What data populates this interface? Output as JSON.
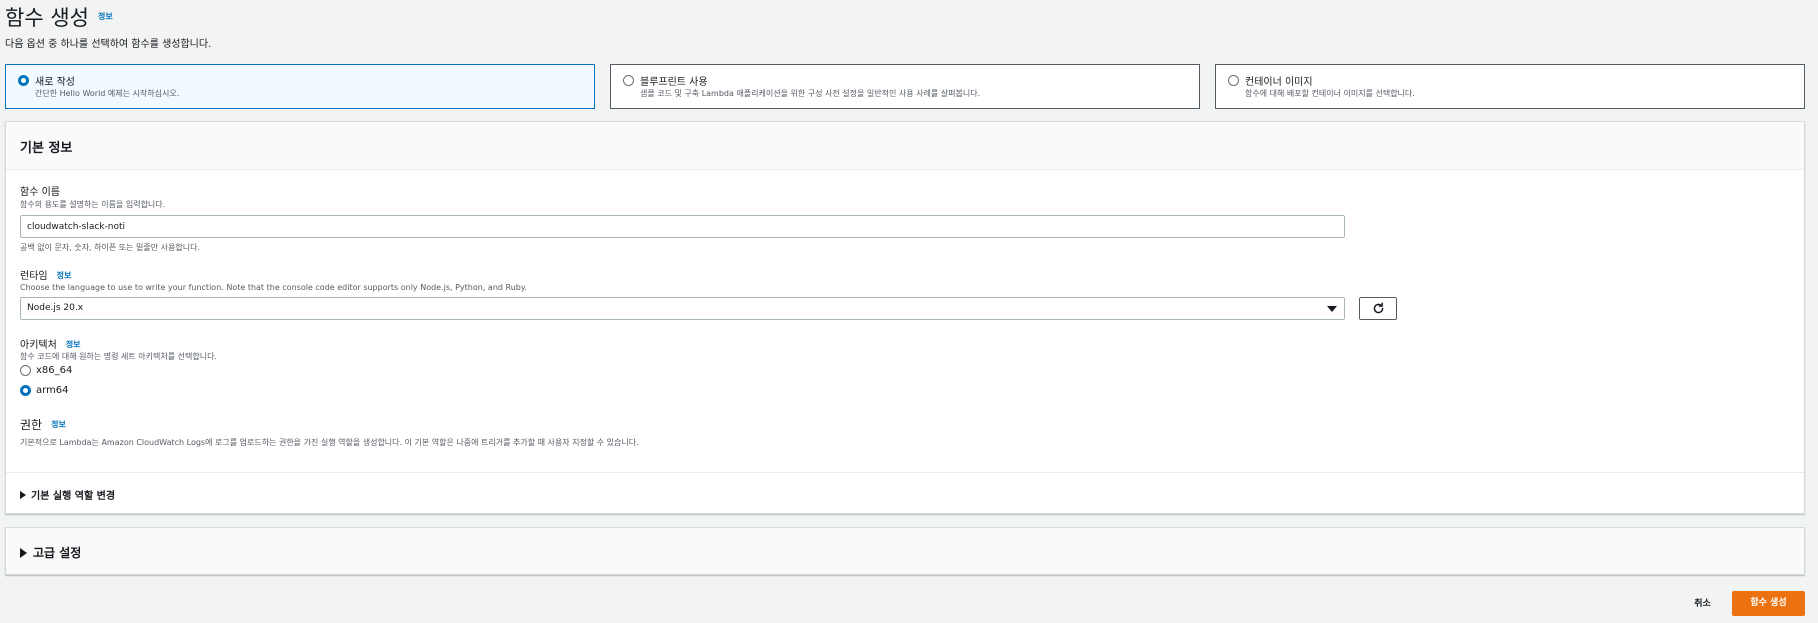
{
  "header": {
    "title": "함수 생성",
    "info": "정보",
    "description": "다음 옵션 중 하나를 선택하여 함수를 생성합니다."
  },
  "options": [
    {
      "title": "새로 작성",
      "description": "간단한 Hello World 예제는 시작하십시오.",
      "selected": true
    },
    {
      "title": "블루프린트 사용",
      "description": "샘플 코드 및 구축 Lambda 애플리케이션을 위한 구성 사전 설정을 일반적인 사용 사례를 살펴봅니다.",
      "selected": false
    },
    {
      "title": "컨테이너 이미지",
      "description": "함수에 대해 배포할 컨테이너 이미지를 선택합니다.",
      "selected": false
    }
  ],
  "basic": {
    "title": "기본 정보",
    "function_name": {
      "label": "함수 이름",
      "description": "함수의 용도를 설명하는 이름을 입력합니다.",
      "value": "cloudwatch-slack-noti",
      "hint": "공백 없이 문자, 숫자, 하이픈 또는 밑줄만 사용합니다."
    },
    "runtime": {
      "label": "런타임",
      "info": "정보",
      "description": "Choose the language to use to write your function. Note that the console code editor supports only Node.js, Python, and Ruby.",
      "value": "Node.js 20.x",
      "refresh_icon": "refresh-icon"
    },
    "architecture": {
      "label": "아키텍처",
      "info": "정보",
      "description": "함수 코드에 대해 원하는 명령 세트 아키텍처를 선택합니다.",
      "options": [
        {
          "label": "x86_64",
          "selected": false
        },
        {
          "label": "arm64",
          "selected": true
        }
      ]
    },
    "permissions": {
      "title": "권한",
      "info": "정보",
      "description": "기본적으로 Lambda는 Amazon CloudWatch Logs에 로그를 업로드하는 권한을 가진 실행 역할을 생성합니다. 이 기본 역할은 나중에 트리거를 추가할 때 사용자 지정할 수 있습니다."
    },
    "change_role": "기본 실행 역할 변경"
  },
  "advanced": {
    "title": "고급 설정"
  },
  "footer": {
    "cancel": "취소",
    "create": "함수 생성"
  },
  "colors": {
    "accent": "#0073bb",
    "primary_button": "#ec7211",
    "selected_tile_bg": "#f1faff"
  }
}
